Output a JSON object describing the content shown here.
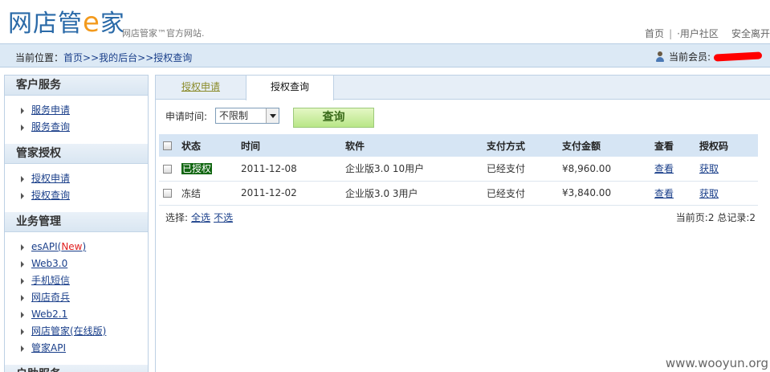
{
  "header": {
    "logo_part1": "网店",
    "logo_part2": "管",
    "logo_e": "e",
    "logo_part3": "家",
    "tagline": "网店管家™官方网站.",
    "nav": [
      "首页",
      "·用户社区",
      "安全离开"
    ],
    "nav_sep": "|"
  },
  "crumbbar": {
    "prefix": "当前位置：",
    "links": [
      "首页",
      "我的后台",
      "授权查询"
    ],
    "sep": ">>",
    "member_label": "当前会员:"
  },
  "sidebar": {
    "sections": [
      {
        "title": "客户服务",
        "items": [
          "服务申请",
          "服务查询"
        ]
      },
      {
        "title": "管家授权",
        "items": [
          "授权申请",
          "授权查询"
        ]
      },
      {
        "title": "业务管理",
        "items": [
          "esAPI",
          "Web3.0",
          "手机短信",
          "网店奇兵",
          "Web2.1",
          "网店管家(在线版)",
          "管家API"
        ]
      },
      {
        "title": "户助服务"
      }
    ],
    "new_open": "(",
    "new_label": "New",
    "new_close": ")"
  },
  "tabs": [
    "授权申请",
    "授权查询"
  ],
  "filter": {
    "label": "申请时间:",
    "select_value": "不限制",
    "query_button": "查询"
  },
  "table": {
    "headers": [
      "状态",
      "时间",
      "软件",
      "支付方式",
      "支付金额",
      "查看",
      "授权码"
    ],
    "rows": [
      {
        "status": "已授权",
        "time": "2011-12-08",
        "software": "企业版3.0 10用户",
        "pay_method": "已经支付",
        "amount": "¥8,960.00",
        "view": "查看",
        "code": "获取"
      },
      {
        "status": "冻结",
        "time": "2011-12-02",
        "software": "企业版3.0 3用户",
        "pay_method": "已经支付",
        "amount": "¥3,840.00",
        "view": "查看",
        "code": "获取"
      }
    ]
  },
  "footer": {
    "select_label": "选择:",
    "select_all": "全选",
    "select_none": "不选",
    "current_page": "当前页:2",
    "total_records": "总记录:2"
  },
  "watermark": "www.wooyun.org",
  "colors": {
    "accent": "#2a6aa8",
    "logo_e": "#f39a1d",
    "new": "#e02020",
    "authorized_bg": "#116611"
  }
}
